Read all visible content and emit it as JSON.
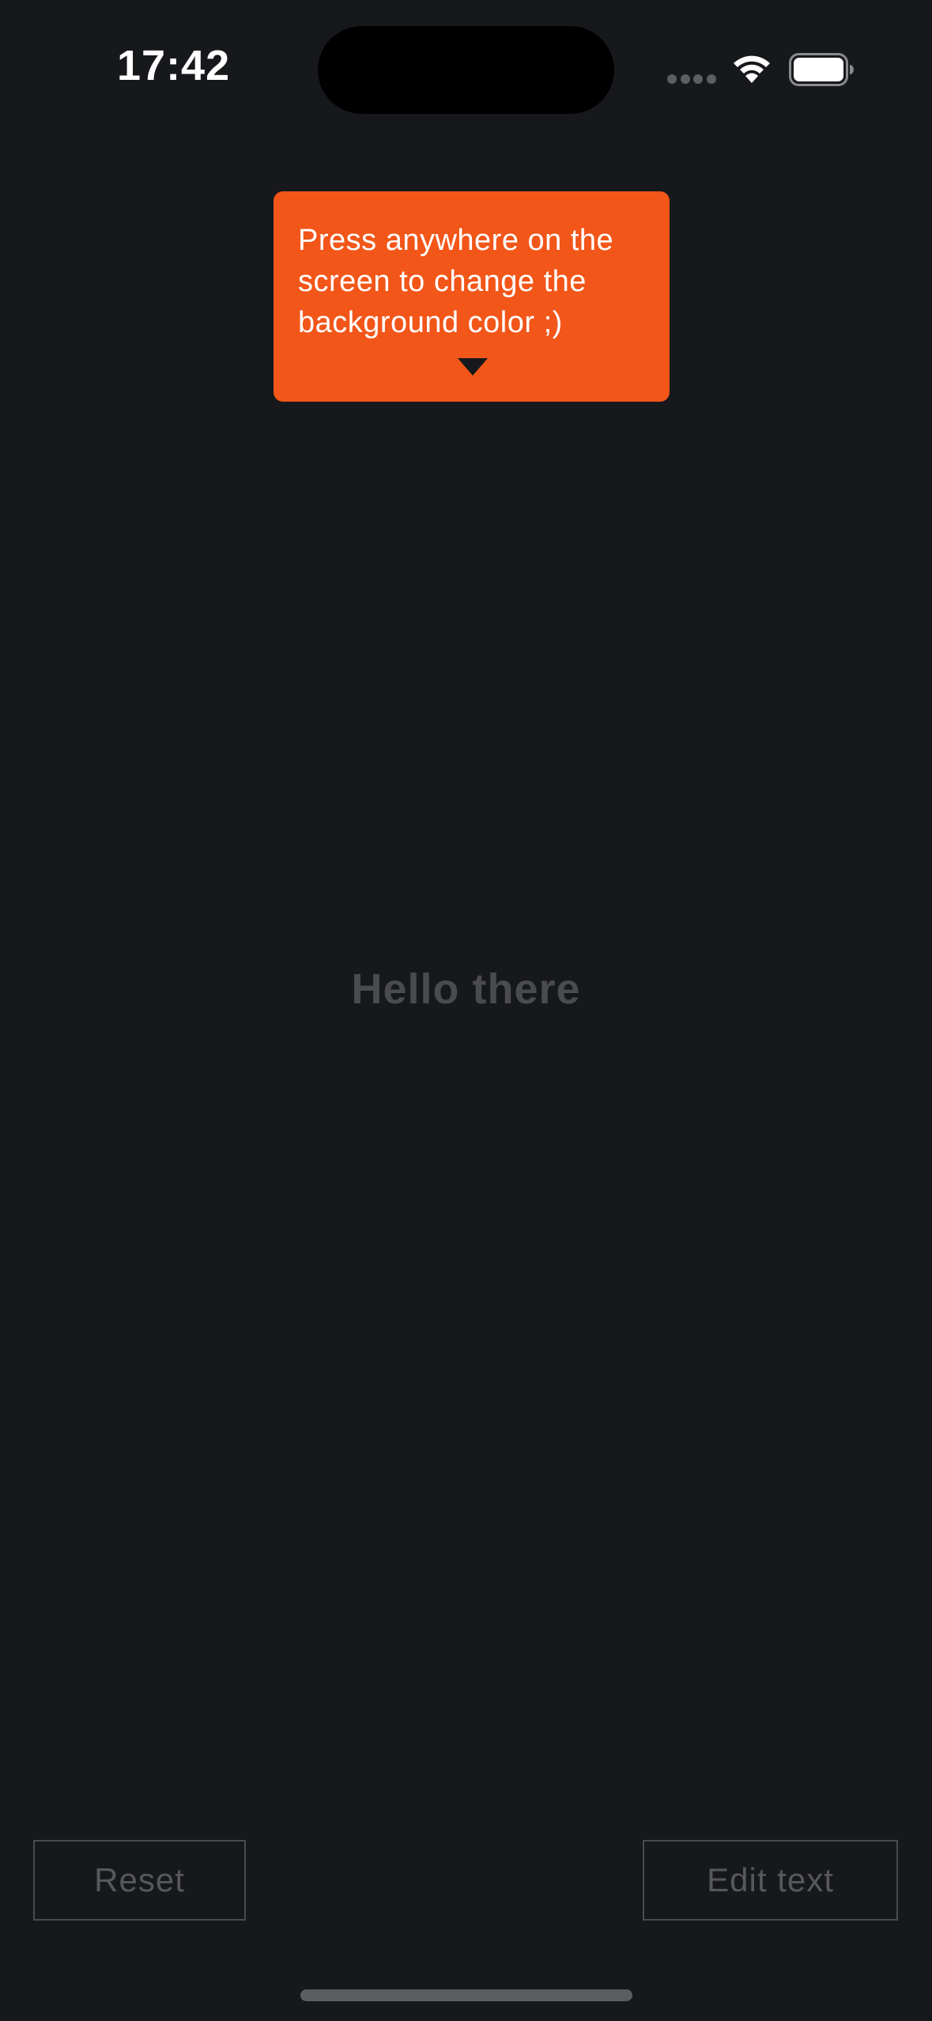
{
  "status_bar": {
    "time": "17:42",
    "icons": [
      "signal-dots-icon",
      "wifi-icon",
      "battery-icon"
    ]
  },
  "tooltip": {
    "text": "Press anywhere on the screen to change the background color ;)",
    "background_color": "#f25619",
    "arrow_icon": "triangle-down-icon"
  },
  "main": {
    "text": "Hello there",
    "background_color": "#17181c"
  },
  "buttons": {
    "reset_label": "Reset",
    "edit_label": "Edit text"
  }
}
